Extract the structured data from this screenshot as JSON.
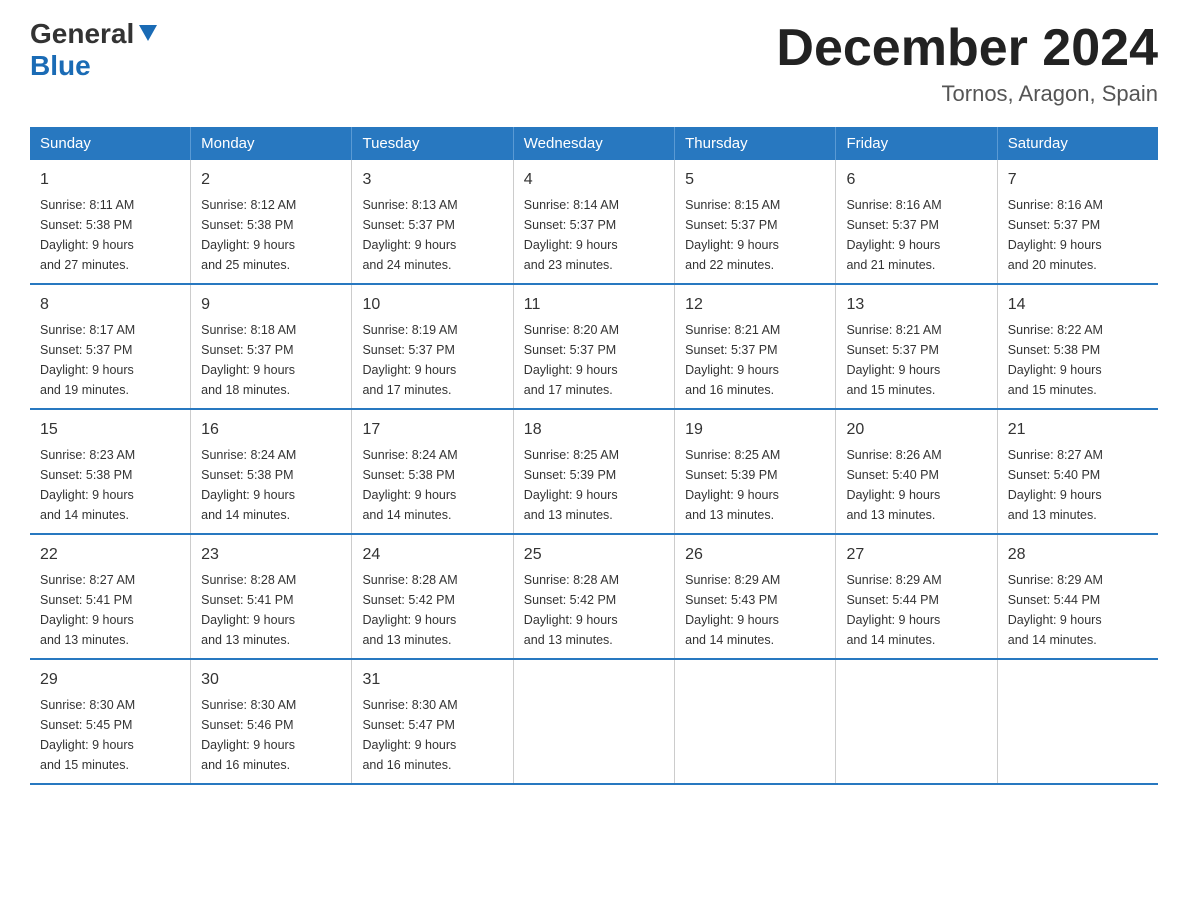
{
  "header": {
    "logo_general": "General",
    "logo_blue": "Blue",
    "month_title": "December 2024",
    "location": "Tornos, Aragon, Spain"
  },
  "weekdays": [
    "Sunday",
    "Monday",
    "Tuesday",
    "Wednesday",
    "Thursday",
    "Friday",
    "Saturday"
  ],
  "weeks": [
    [
      {
        "day": "1",
        "sunrise": "8:11 AM",
        "sunset": "5:38 PM",
        "daylight": "9 hours and 27 minutes."
      },
      {
        "day": "2",
        "sunrise": "8:12 AM",
        "sunset": "5:38 PM",
        "daylight": "9 hours and 25 minutes."
      },
      {
        "day": "3",
        "sunrise": "8:13 AM",
        "sunset": "5:37 PM",
        "daylight": "9 hours and 24 minutes."
      },
      {
        "day": "4",
        "sunrise": "8:14 AM",
        "sunset": "5:37 PM",
        "daylight": "9 hours and 23 minutes."
      },
      {
        "day": "5",
        "sunrise": "8:15 AM",
        "sunset": "5:37 PM",
        "daylight": "9 hours and 22 minutes."
      },
      {
        "day": "6",
        "sunrise": "8:16 AM",
        "sunset": "5:37 PM",
        "daylight": "9 hours and 21 minutes."
      },
      {
        "day": "7",
        "sunrise": "8:16 AM",
        "sunset": "5:37 PM",
        "daylight": "9 hours and 20 minutes."
      }
    ],
    [
      {
        "day": "8",
        "sunrise": "8:17 AM",
        "sunset": "5:37 PM",
        "daylight": "9 hours and 19 minutes."
      },
      {
        "day": "9",
        "sunrise": "8:18 AM",
        "sunset": "5:37 PM",
        "daylight": "9 hours and 18 minutes."
      },
      {
        "day": "10",
        "sunrise": "8:19 AM",
        "sunset": "5:37 PM",
        "daylight": "9 hours and 17 minutes."
      },
      {
        "day": "11",
        "sunrise": "8:20 AM",
        "sunset": "5:37 PM",
        "daylight": "9 hours and 17 minutes."
      },
      {
        "day": "12",
        "sunrise": "8:21 AM",
        "sunset": "5:37 PM",
        "daylight": "9 hours and 16 minutes."
      },
      {
        "day": "13",
        "sunrise": "8:21 AM",
        "sunset": "5:37 PM",
        "daylight": "9 hours and 15 minutes."
      },
      {
        "day": "14",
        "sunrise": "8:22 AM",
        "sunset": "5:38 PM",
        "daylight": "9 hours and 15 minutes."
      }
    ],
    [
      {
        "day": "15",
        "sunrise": "8:23 AM",
        "sunset": "5:38 PM",
        "daylight": "9 hours and 14 minutes."
      },
      {
        "day": "16",
        "sunrise": "8:24 AM",
        "sunset": "5:38 PM",
        "daylight": "9 hours and 14 minutes."
      },
      {
        "day": "17",
        "sunrise": "8:24 AM",
        "sunset": "5:38 PM",
        "daylight": "9 hours and 14 minutes."
      },
      {
        "day": "18",
        "sunrise": "8:25 AM",
        "sunset": "5:39 PM",
        "daylight": "9 hours and 13 minutes."
      },
      {
        "day": "19",
        "sunrise": "8:25 AM",
        "sunset": "5:39 PM",
        "daylight": "9 hours and 13 minutes."
      },
      {
        "day": "20",
        "sunrise": "8:26 AM",
        "sunset": "5:40 PM",
        "daylight": "9 hours and 13 minutes."
      },
      {
        "day": "21",
        "sunrise": "8:27 AM",
        "sunset": "5:40 PM",
        "daylight": "9 hours and 13 minutes."
      }
    ],
    [
      {
        "day": "22",
        "sunrise": "8:27 AM",
        "sunset": "5:41 PM",
        "daylight": "9 hours and 13 minutes."
      },
      {
        "day": "23",
        "sunrise": "8:28 AM",
        "sunset": "5:41 PM",
        "daylight": "9 hours and 13 minutes."
      },
      {
        "day": "24",
        "sunrise": "8:28 AM",
        "sunset": "5:42 PM",
        "daylight": "9 hours and 13 minutes."
      },
      {
        "day": "25",
        "sunrise": "8:28 AM",
        "sunset": "5:42 PM",
        "daylight": "9 hours and 13 minutes."
      },
      {
        "day": "26",
        "sunrise": "8:29 AM",
        "sunset": "5:43 PM",
        "daylight": "9 hours and 14 minutes."
      },
      {
        "day": "27",
        "sunrise": "8:29 AM",
        "sunset": "5:44 PM",
        "daylight": "9 hours and 14 minutes."
      },
      {
        "day": "28",
        "sunrise": "8:29 AM",
        "sunset": "5:44 PM",
        "daylight": "9 hours and 14 minutes."
      }
    ],
    [
      {
        "day": "29",
        "sunrise": "8:30 AM",
        "sunset": "5:45 PM",
        "daylight": "9 hours and 15 minutes."
      },
      {
        "day": "30",
        "sunrise": "8:30 AM",
        "sunset": "5:46 PM",
        "daylight": "9 hours and 16 minutes."
      },
      {
        "day": "31",
        "sunrise": "8:30 AM",
        "sunset": "5:47 PM",
        "daylight": "9 hours and 16 minutes."
      },
      {
        "day": "",
        "sunrise": "",
        "sunset": "",
        "daylight": ""
      },
      {
        "day": "",
        "sunrise": "",
        "sunset": "",
        "daylight": ""
      },
      {
        "day": "",
        "sunrise": "",
        "sunset": "",
        "daylight": ""
      },
      {
        "day": "",
        "sunrise": "",
        "sunset": "",
        "daylight": ""
      }
    ]
  ],
  "labels": {
    "sunrise": "Sunrise:",
    "sunset": "Sunset:",
    "daylight": "Daylight:"
  }
}
